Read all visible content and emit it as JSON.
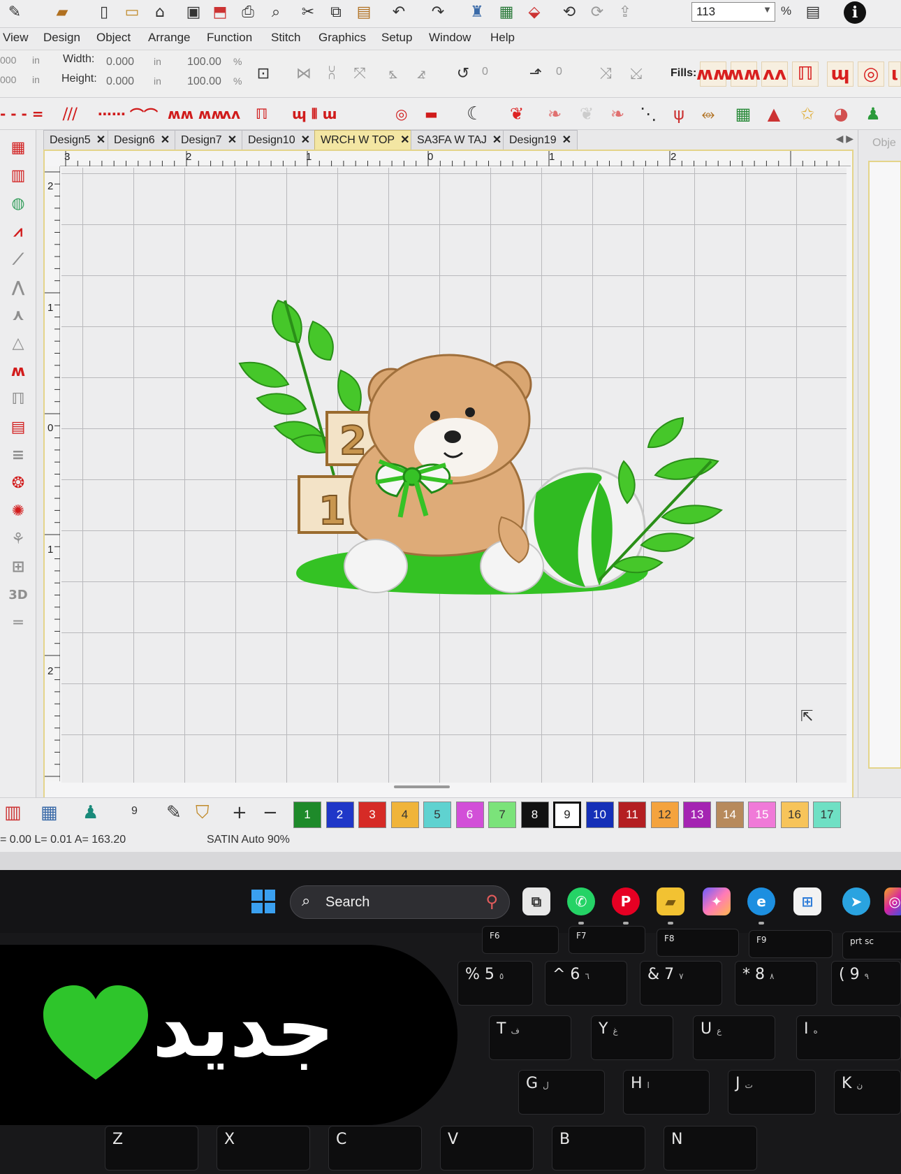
{
  "menu": [
    "View",
    "Design",
    "Object",
    "Arrange",
    "Function",
    "Stitch",
    "Graphics",
    "Setup",
    "Window",
    "Help"
  ],
  "toolbar": {
    "zoom_value": "113",
    "zoom_unit": "%"
  },
  "size": {
    "width_label": "Width:",
    "width_value": "0.000",
    "width_unit": "in",
    "width_pct": "100.00",
    "height_label": "Height:",
    "height_value": "0.000",
    "height_unit": "in",
    "height_pct": "100.00",
    "pct_sign": "%",
    "left_val_1": "000",
    "left_val_2": "000",
    "left_unit": "in",
    "rotate_value": "0",
    "skew_value": "0"
  },
  "fills_label": "Fills:",
  "tabs": [
    {
      "label": "Design5",
      "active": false
    },
    {
      "label": "Design6",
      "active": false
    },
    {
      "label": "Design7",
      "active": false
    },
    {
      "label": "Design10",
      "active": false
    },
    {
      "label": "WRCH W TOP",
      "active": true
    },
    {
      "label": "SA3FA W TAJ",
      "active": false
    },
    {
      "label": "Design19",
      "active": false
    }
  ],
  "ruler": {
    "h_labels": [
      "3",
      "2",
      "1",
      "0",
      "1",
      "2"
    ],
    "v_labels": [
      "2",
      "1",
      "0",
      "1",
      "2"
    ]
  },
  "right_panel_title": "Obje",
  "colorbar": {
    "input_value": "9",
    "swatches": [
      {
        "n": "1",
        "color": "#1e8a2a"
      },
      {
        "n": "2",
        "color": "#1f37c8"
      },
      {
        "n": "3",
        "color": "#d62b26"
      },
      {
        "n": "4",
        "color": "#f0b43a"
      },
      {
        "n": "5",
        "color": "#5fd2d0"
      },
      {
        "n": "6",
        "color": "#d24fd8"
      },
      {
        "n": "7",
        "color": "#7be37a"
      },
      {
        "n": "8",
        "color": "#111111"
      },
      {
        "n": "9",
        "color": "#ffffff"
      },
      {
        "n": "10",
        "color": "#1530b8"
      },
      {
        "n": "11",
        "color": "#b41f22"
      },
      {
        "n": "12",
        "color": "#f4a33e"
      },
      {
        "n": "13",
        "color": "#a424b2"
      },
      {
        "n": "14",
        "color": "#b78a5c"
      },
      {
        "n": "15",
        "color": "#f07ad8"
      },
      {
        "n": "16",
        "color": "#f7c45a"
      },
      {
        "n": "17",
        "color": "#6fe0c4"
      }
    ]
  },
  "status": {
    "coords": "= 0.00 L=  0.01 A= 163.20",
    "stitch_mode": "SATIN Auto 90%"
  },
  "taskbar": {
    "search_placeholder": "Search"
  },
  "keyboard": {
    "fn_keys": [
      "F6",
      "F7",
      "F8",
      "F9",
      "prt sc"
    ],
    "row1": [
      "% 5",
      "^ 6",
      "& 7",
      "* 8",
      "( 9"
    ],
    "row1_ar": [
      "٥",
      "٦",
      "٧",
      "٨",
      "٩"
    ],
    "row2": [
      "T",
      "Y",
      "U",
      "I"
    ],
    "row2_ar": [
      "ف",
      "غ",
      "ع",
      "ه"
    ],
    "row3": [
      "G",
      "H",
      "J",
      "K"
    ],
    "row3_ar": [
      "ل",
      "ا",
      "ت",
      "ن"
    ],
    "row4": [
      "Z",
      "X",
      "C",
      "V",
      "B",
      "N"
    ]
  },
  "caption": {
    "text": "جديد",
    "heart_color": "#2ec52b"
  }
}
